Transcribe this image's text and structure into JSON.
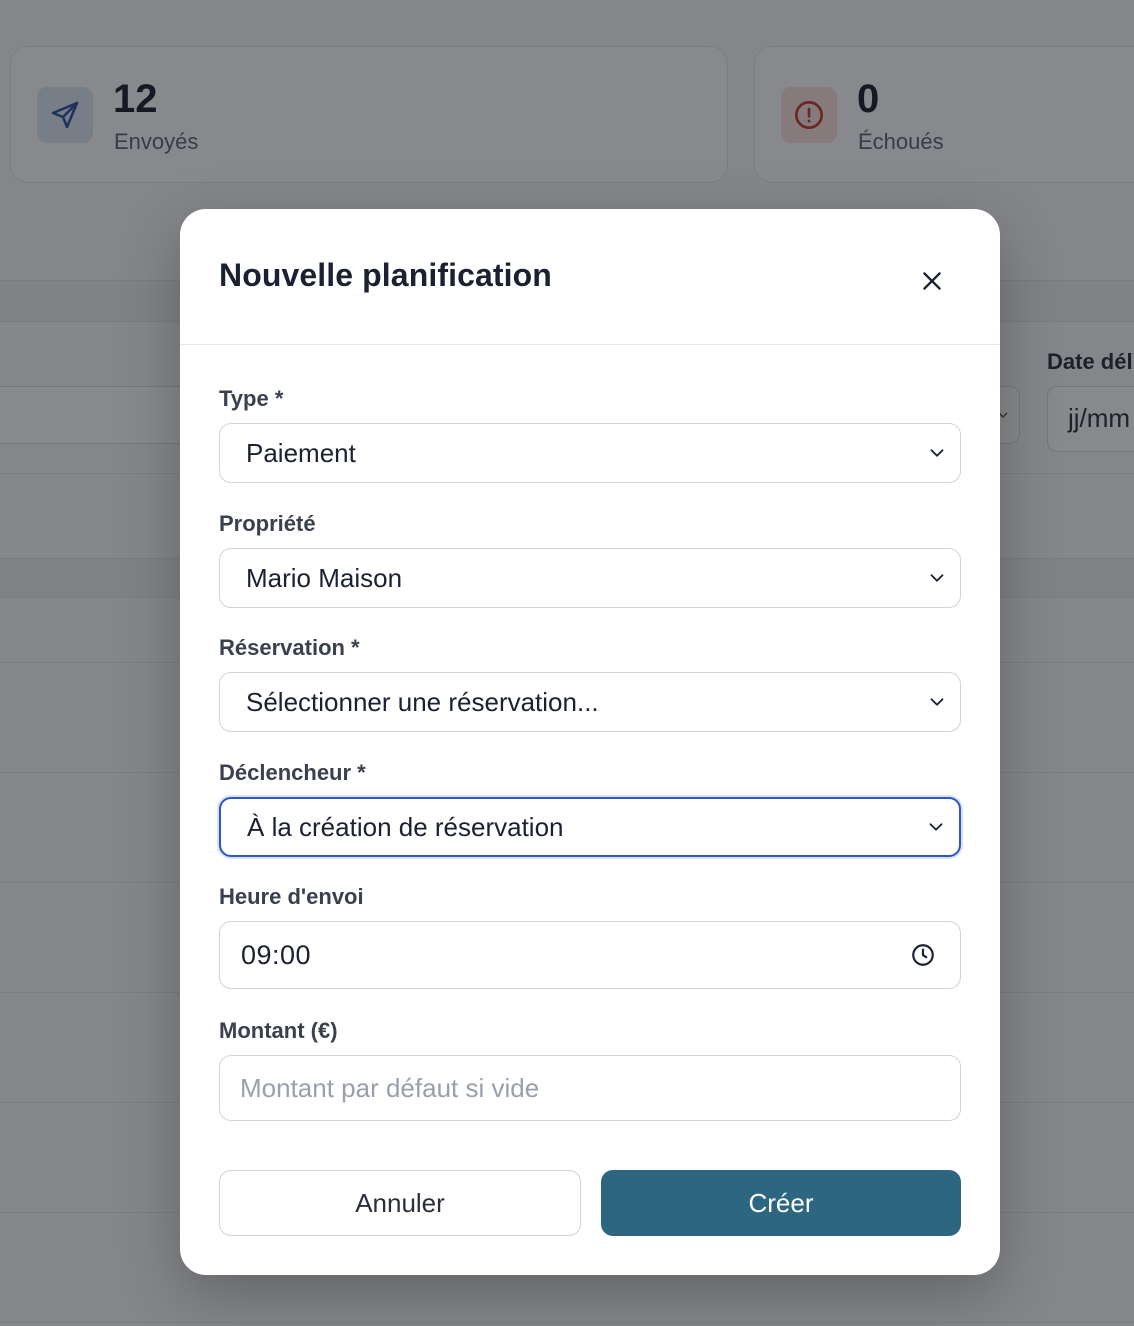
{
  "background": {
    "stats": [
      {
        "value": "12",
        "label": "Envoyés",
        "icon": "send-icon"
      },
      {
        "value": "0",
        "label": "Échoués",
        "icon": "alert-circle-icon"
      }
    ],
    "filter": {
      "date_label": "Date dél",
      "date_placeholder": "jj/mm"
    }
  },
  "modal": {
    "title": "Nouvelle planification",
    "close_icon": "close-icon",
    "fields": {
      "type": {
        "label": "Type *",
        "value": "Paiement"
      },
      "property": {
        "label": "Propriété",
        "value": "Mario Maison"
      },
      "reservation": {
        "label": "Réservation *",
        "value": "Sélectionner une réservation..."
      },
      "trigger": {
        "label": "Déclencheur *",
        "value": "À la création de réservation"
      },
      "send_time": {
        "label": "Heure d'envoi",
        "value": "09:00"
      },
      "amount": {
        "label": "Montant (€)",
        "placeholder": "Montant par défaut si vide"
      }
    },
    "buttons": {
      "cancel": "Annuler",
      "create": "Créer"
    }
  },
  "colors": {
    "primary": "#2c6680",
    "focus": "#2b56c8",
    "sent_icon_bg": "#dfe8f7",
    "sent_icon": "#2f4f9e",
    "failed_icon_bg": "#fbe1e1",
    "failed_icon": "#c0392b"
  }
}
